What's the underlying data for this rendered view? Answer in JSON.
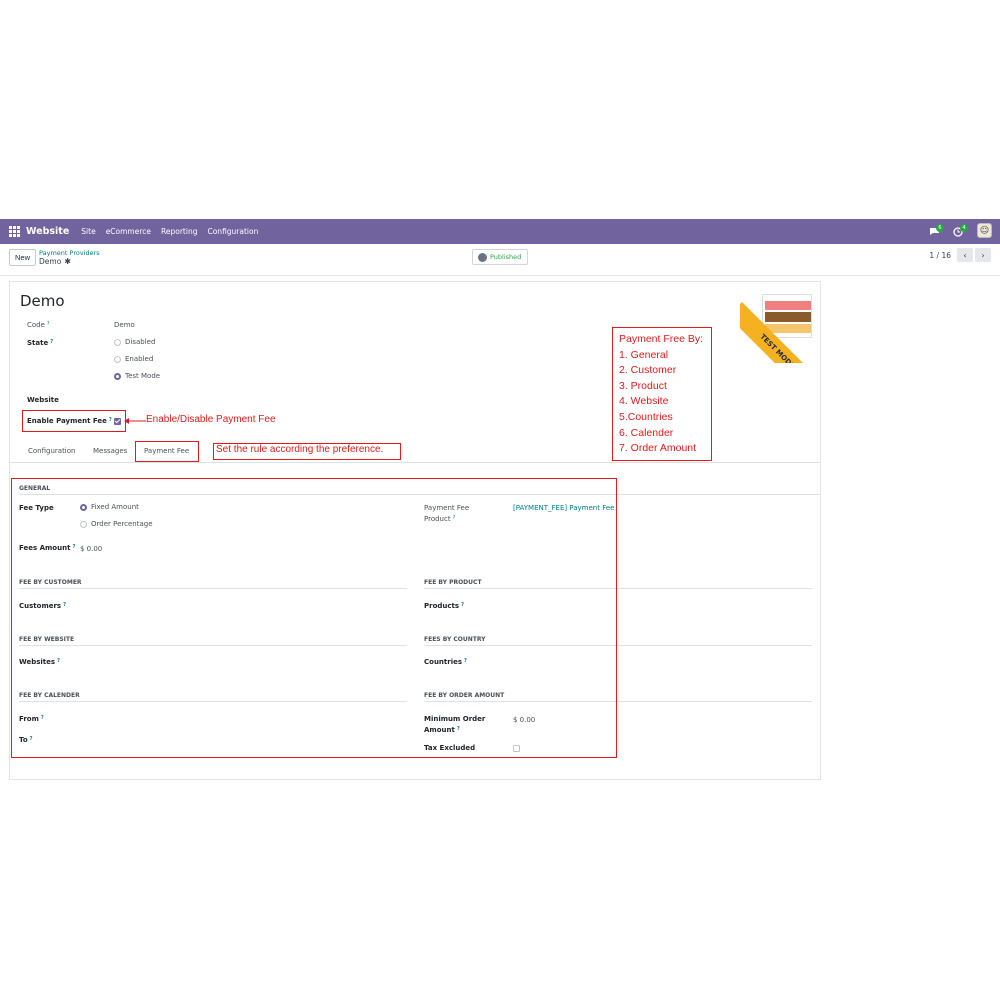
{
  "nav": {
    "app_title": "Website",
    "menu": [
      "Site",
      "eCommerce",
      "Reporting",
      "Configuration"
    ],
    "chat_badge": "6",
    "activity_badge": "4"
  },
  "control": {
    "new_label": "New",
    "breadcrumb_parent": "Payment Providers",
    "breadcrumb_current": "Demo",
    "published_label": "Published",
    "pager": "1 / 16"
  },
  "record": {
    "title": "Demo",
    "code_label": "Code",
    "code_value": "Demo",
    "state_label": "State",
    "state_options": [
      "Disabled",
      "Enabled",
      "Test Mode"
    ],
    "state_selected": "Test Mode",
    "website_label": "Website",
    "enable_fee_label": "Enable Payment Fee",
    "enable_fee_checked": true,
    "ribbon": "TEST MODE"
  },
  "tabs": [
    "Configuration",
    "Messages",
    "Payment Fee"
  ],
  "payment_fee": {
    "general_header": "GENERAL",
    "fee_type_label": "Fee Type",
    "fee_type_options": [
      "Fixed Amount",
      "Order Percentage"
    ],
    "fee_type_selected": "Fixed Amount",
    "fees_amount_label": "Fees Amount",
    "fees_amount_value": "$ 0.00",
    "fee_product_label_1": "Payment Fee",
    "fee_product_label_2": "Product",
    "fee_product_value": "[PAYMENT_FEE] Payment Fee",
    "by_customer_header": "FEE BY CUSTOMER",
    "customers_label": "Customers",
    "by_product_header": "FEE BY PRODUCT",
    "products_label": "Products",
    "by_website_header": "FEE BY WEBSITE",
    "websites_label": "Websites",
    "by_country_header": "FEES BY COUNTRY",
    "countries_label": "Countries",
    "by_calender_header": "FEE BY CALENDER",
    "from_label": "From",
    "to_label": "To",
    "by_order_header": "FEE BY ORDER AMOUNT",
    "min_order_label_1": "Minimum Order",
    "min_order_label_2": "Amount",
    "min_order_value": "$ 0.00",
    "tax_excluded_label": "Tax Excluded"
  },
  "annotations": {
    "enable_note": "Enable/Disable Payment Fee",
    "rule_note": "Set the rule according the preference.",
    "list_title": "Payment Free By:",
    "list_items": [
      "1. General",
      "2. Customer",
      "3. Product",
      "4. Website",
      "5.Countries",
      "6. Calender",
      "7. Order Amount"
    ]
  },
  "colors": {
    "navbar": "#71639e",
    "accent": "#017e84",
    "ribbon": "#f5b120",
    "annotation": "#e01b1b",
    "published": "#28a745"
  }
}
